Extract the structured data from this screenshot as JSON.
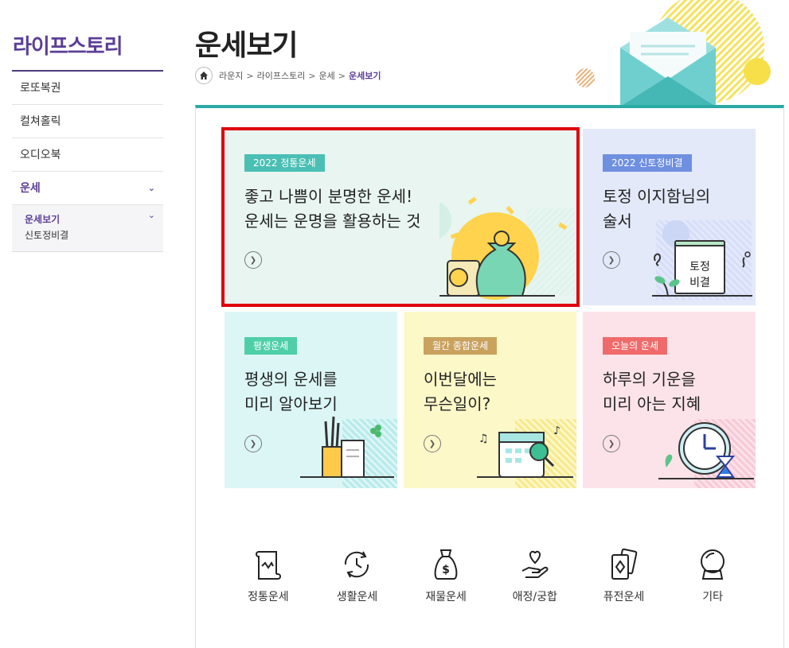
{
  "sidebar": {
    "title": "라이프스토리",
    "items": [
      "로또복권",
      "컬쳐홀릭",
      "오디오북",
      "운세"
    ],
    "sub_items": [
      "운세보기",
      "신토정비결"
    ]
  },
  "header": {
    "title": "운세보기",
    "breadcrumb": [
      "라운지",
      "라이프스토리",
      "운세",
      "운세보기"
    ]
  },
  "cards": [
    {
      "tag": "2022 정통운세",
      "line1": "좋고 나쁨이 분명한 운세!",
      "line2": "운세는 운명을 활용하는 것",
      "tag_color": "#4bbfb4"
    },
    {
      "tag": "2022 신토정비결",
      "line1": "토정 이지함님의",
      "line2": "술서",
      "book1": "토정",
      "book2": "비결",
      "tag_color": "#6f8fe0"
    },
    {
      "tag": "평생운세",
      "line1": "평생의 운세를",
      "line2": "미리 알아보기",
      "tag_color": "#4fcfa8"
    },
    {
      "tag": "월간 종합운세",
      "line1": "이번달에는",
      "line2": "무슨일이?",
      "tag_color": "#c9a25e"
    },
    {
      "tag": "오늘의 운세",
      "line1": "하루의 기운을",
      "line2": "미리 아는 지혜",
      "tag_color": "#ef6b6b"
    }
  ],
  "categories": [
    {
      "label": "정통운세",
      "icon": "scroll-icon"
    },
    {
      "label": "생활운세",
      "icon": "cycle-icon"
    },
    {
      "label": "재물운세",
      "icon": "money-bag-icon"
    },
    {
      "label": "애정/궁합",
      "icon": "heart-hand-icon"
    },
    {
      "label": "퓨전운세",
      "icon": "cards-icon"
    },
    {
      "label": "기타",
      "icon": "crystal-ball-icon"
    }
  ],
  "colors": {
    "brand": "#5b3f97",
    "accent": "#2ba9a5",
    "highlight": "#e0000f"
  }
}
